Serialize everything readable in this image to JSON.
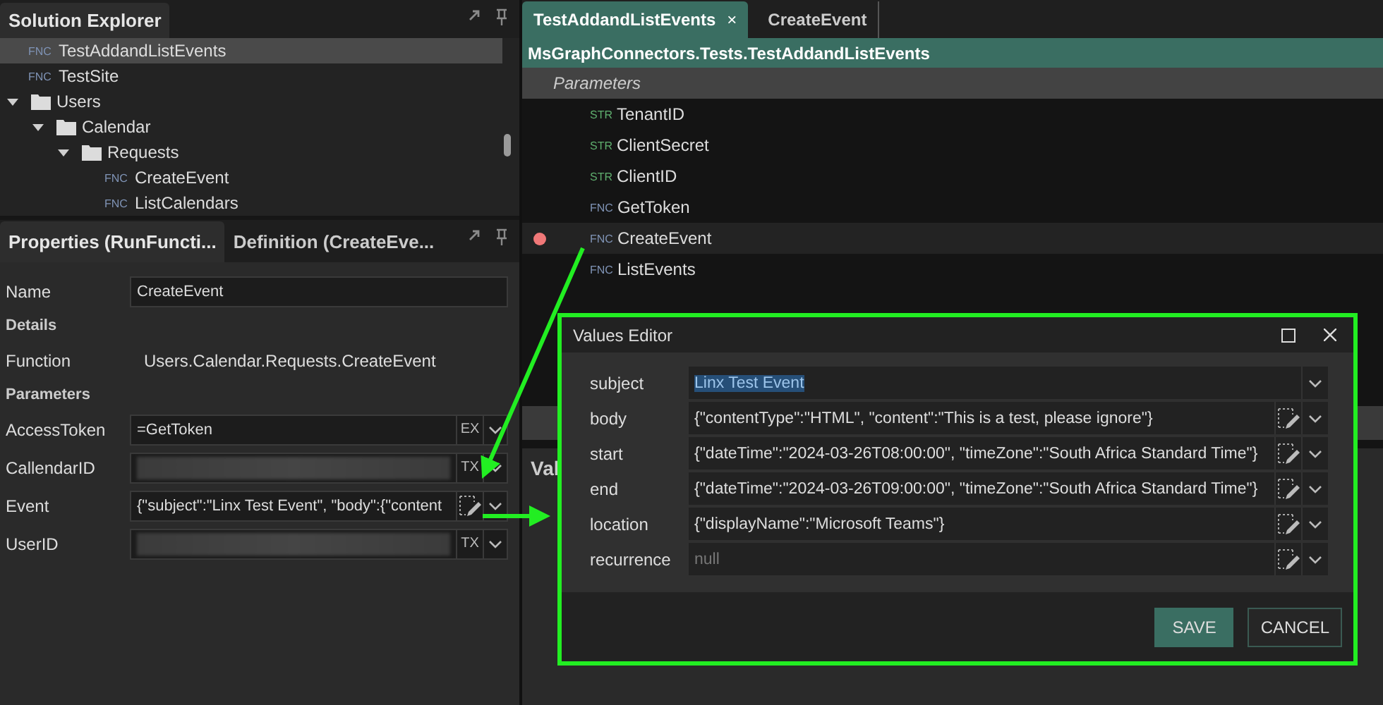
{
  "solution_explorer": {
    "title": "Solution Explorer",
    "items": [
      {
        "kind": "function",
        "badge": "FNC",
        "label": "TestAddandListEvents",
        "selected": true
      },
      {
        "kind": "function",
        "badge": "FNC",
        "label": "TestSite",
        "selected": false
      },
      {
        "kind": "folder",
        "label": "Users",
        "expanded": true,
        "selected": false,
        "children": [
          {
            "kind": "folder",
            "label": "Calendar",
            "expanded": true,
            "selected": false,
            "children": [
              {
                "kind": "folder",
                "label": "Requests",
                "expanded": true,
                "selected": false,
                "children": [
                  {
                    "kind": "function",
                    "badge": "FNC",
                    "label": "CreateEvent",
                    "selected": false
                  },
                  {
                    "kind": "function",
                    "badge": "FNC",
                    "label": "ListCalendars",
                    "selected": false
                  }
                ]
              }
            ]
          }
        ]
      }
    ]
  },
  "properties": {
    "tabs": [
      {
        "label": "Properties (RunFuncti...",
        "selected": true
      },
      {
        "label": "Definition (CreateEve...",
        "selected": false
      }
    ],
    "rows": [
      {
        "kind": "field",
        "label": "Name",
        "value": "CreateEvent"
      },
      {
        "kind": "section",
        "label": "Details"
      },
      {
        "kind": "text",
        "label": "Function",
        "value": "Users.Calendar.Requests.CreateEvent"
      },
      {
        "kind": "section",
        "label": "Parameters"
      },
      {
        "kind": "param",
        "label": "AccessToken",
        "value": "=GetToken",
        "mode": "EX"
      },
      {
        "kind": "param",
        "label": "CallendarID",
        "redacted": true,
        "mode": "TX"
      },
      {
        "kind": "param",
        "label": "Event",
        "value": "{\"subject\":\"Linx Test Event\", \"body\":{\"content",
        "editor": true
      },
      {
        "kind": "param",
        "label": "UserID",
        "redacted": true,
        "mode": "TX"
      }
    ]
  },
  "editor": {
    "tabs": [
      {
        "label": "TestAddandListEvents",
        "selected": true,
        "close": "×"
      },
      {
        "label": "CreateEvent",
        "selected": false
      }
    ],
    "header": "MsGraphConnectors.Tests.TestAddandListEvents",
    "section": "Parameters",
    "items": [
      {
        "badge": "STR",
        "kind": "string",
        "label": "TenantID",
        "breakpoint": false,
        "selected": false
      },
      {
        "badge": "STR",
        "kind": "string",
        "label": "ClientSecret",
        "breakpoint": false,
        "selected": false
      },
      {
        "badge": "STR",
        "kind": "string",
        "label": "ClientID",
        "breakpoint": false,
        "selected": false
      },
      {
        "badge": "FNC",
        "kind": "function",
        "label": "GetToken",
        "breakpoint": false,
        "selected": false
      },
      {
        "badge": "FNC",
        "kind": "function",
        "label": "CreateEvent",
        "breakpoint": true,
        "selected": true
      },
      {
        "badge": "FNC",
        "kind": "function",
        "label": "ListEvents",
        "breakpoint": false,
        "selected": false
      }
    ],
    "lower_panel": {
      "title": "Val"
    }
  },
  "values_editor": {
    "title": "Values Editor",
    "rows": [
      {
        "label": "subject",
        "value": "Linx Test Event",
        "highlighted": true,
        "editor": false
      },
      {
        "label": "body",
        "value": "{\"contentType\":\"HTML\", \"content\":\"This is a test, please ignore\"}",
        "highlighted": false,
        "editor": true
      },
      {
        "label": "start",
        "value": "{\"dateTime\":\"2024-03-26T08:00:00\", \"timeZone\":\"South Africa Standard Time\"}",
        "highlighted": false,
        "editor": true
      },
      {
        "label": "end",
        "value": "{\"dateTime\":\"2024-03-26T09:00:00\", \"timeZone\":\"South Africa Standard Time\"}",
        "highlighted": false,
        "editor": true
      },
      {
        "label": "location",
        "value": "{\"displayName\":\"Microsoft Teams\"}",
        "highlighted": false,
        "editor": true
      },
      {
        "label": "recurrence",
        "placeholder": "null",
        "highlighted": false,
        "editor": true
      }
    ],
    "buttons": [
      {
        "label": "SAVE",
        "primary": true
      },
      {
        "label": "CANCEL",
        "primary": false
      }
    ]
  }
}
